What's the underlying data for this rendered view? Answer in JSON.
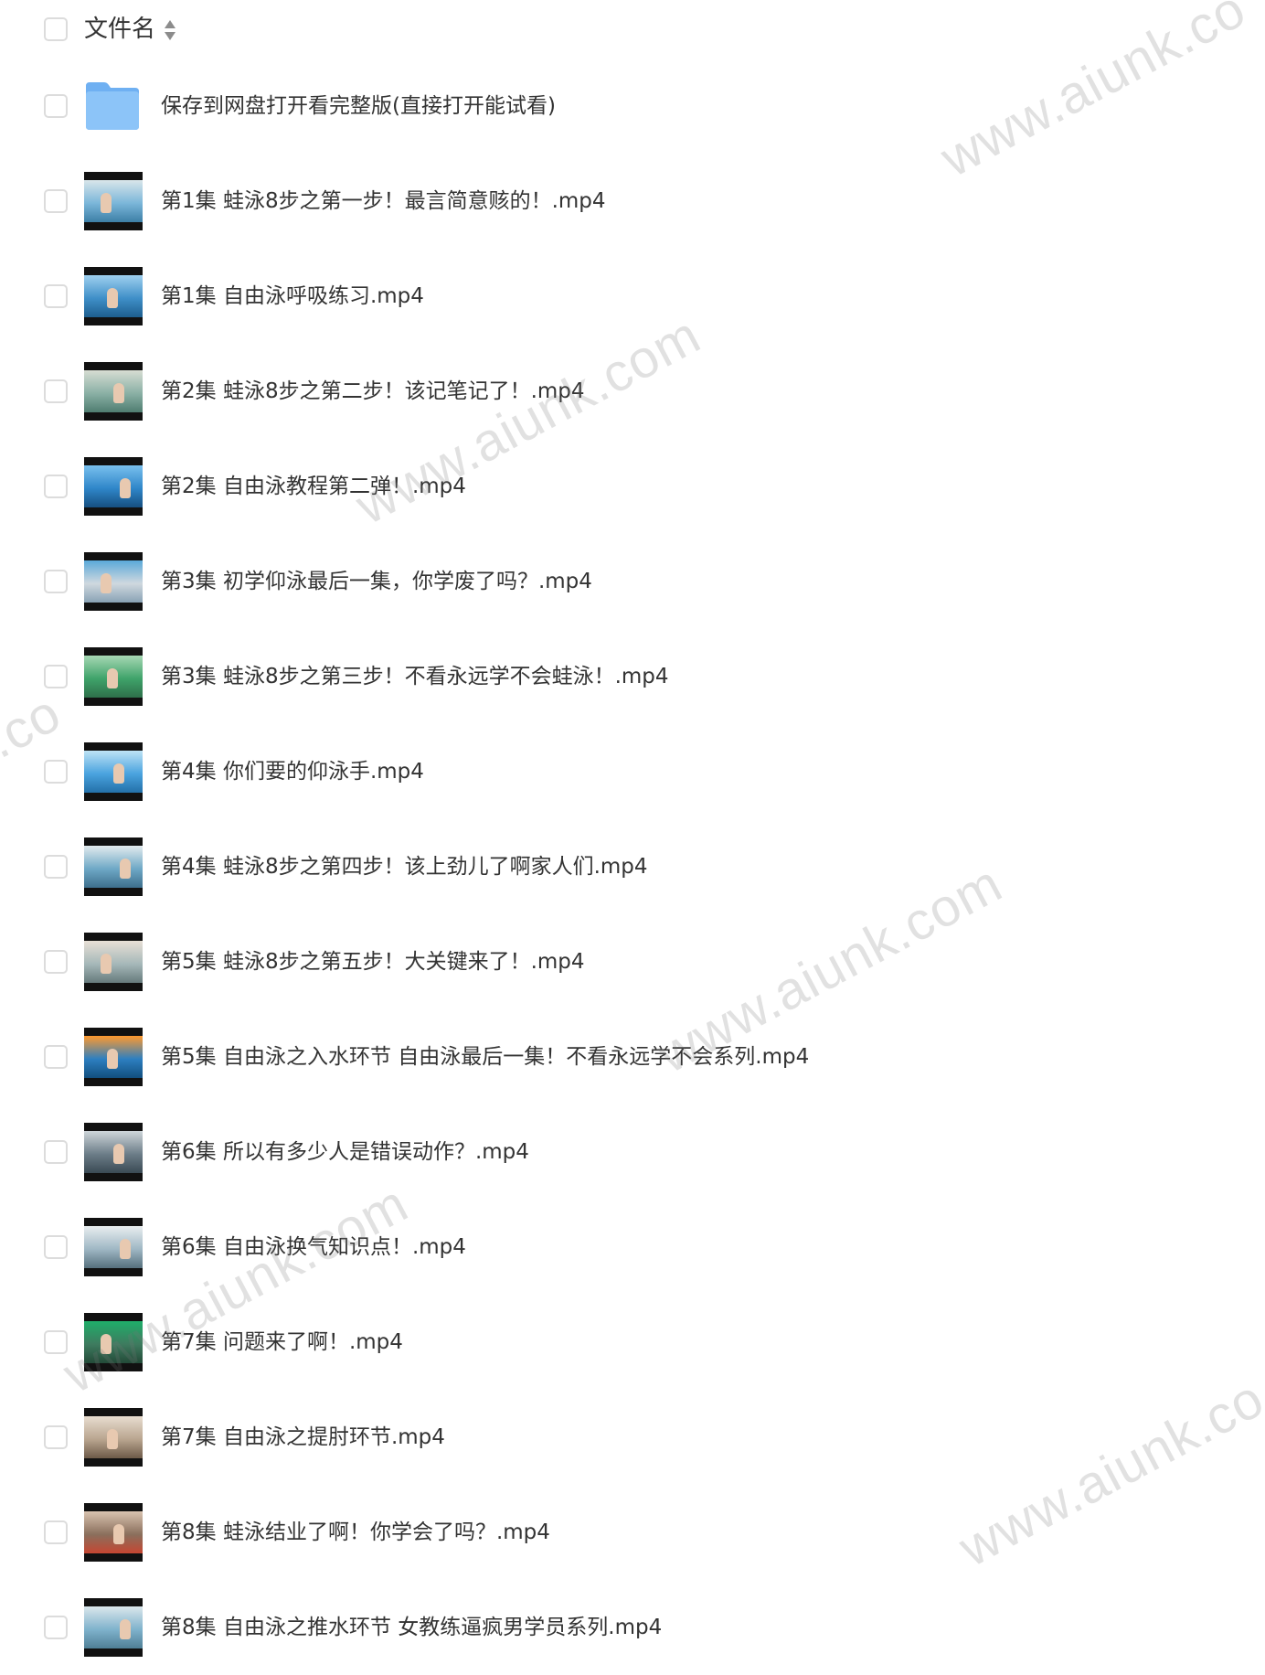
{
  "header": {
    "column_label": "文件名",
    "sort_icon": "sort-updown-icon"
  },
  "folder": {
    "name": "保存到网盘打开看完整版(直接打开能试看)",
    "icon": "folder-icon",
    "color": "#7ab8f5"
  },
  "files": [
    {
      "name": "第1集 蛙泳8步之第一步！最言简意赅的！.mp4",
      "thumb": "pool-swimmer-thumbnail"
    },
    {
      "name": "第1集 自由泳呼吸练习.mp4",
      "thumb": "pool-swimmer-thumbnail"
    },
    {
      "name": "第2集 蛙泳8步之第二步！该记笔记了！.mp4",
      "thumb": "pool-swimmer-thumbnail"
    },
    {
      "name": "第2集 自由泳教程第二弹！.mp4",
      "thumb": "pool-swimmer-thumbnail"
    },
    {
      "name": "第3集 初学仰泳最后一集，你学废了吗？.mp4",
      "thumb": "pool-swimmer-thumbnail"
    },
    {
      "name": "第3集 蛙泳8步之第三步！不看永远学不会蛙泳！.mp4",
      "thumb": "pool-swimmer-thumbnail"
    },
    {
      "name": "第4集 你们要的仰泳手.mp4",
      "thumb": "pool-swimmer-thumbnail"
    },
    {
      "name": "第4集 蛙泳8步之第四步！该上劲儿了啊家人们.mp4",
      "thumb": "pool-swimmer-thumbnail"
    },
    {
      "name": "第5集 蛙泳8步之第五步！大关键来了！.mp4",
      "thumb": "pool-swimmer-thumbnail"
    },
    {
      "name": "第5集 自由泳之入水环节 自由泳最后一集！不看永远学不会系列.mp4",
      "thumb": "pool-swimmer-thumbnail"
    },
    {
      "name": "第6集 所以有多少人是错误动作？.mp4",
      "thumb": "pool-swimmer-thumbnail"
    },
    {
      "name": "第6集 自由泳换气知识点！.mp4",
      "thumb": "pool-swimmer-thumbnail"
    },
    {
      "name": "第7集 问题来了啊！.mp4",
      "thumb": "pool-swimmer-thumbnail"
    },
    {
      "name": "第7集 自由泳之提肘环节.mp4",
      "thumb": "pool-swimmer-thumbnail"
    },
    {
      "name": "第8集 蛙泳结业了啊！你学会了吗？.mp4",
      "thumb": "pool-swimmer-thumbnail"
    },
    {
      "name": "第8集 自由泳之推水环节 女教练逼疯男学员系列.mp4",
      "thumb": "pool-swimmer-thumbnail"
    }
  ],
  "watermark": {
    "text_1": "www.aiunk.co",
    "text_2": "www.aiunk.com",
    "text_3": "k.co",
    "text_4": "www.aiunk.com",
    "text_5": "www.aiunk.com",
    "text_6": "www.aiunk.co"
  }
}
